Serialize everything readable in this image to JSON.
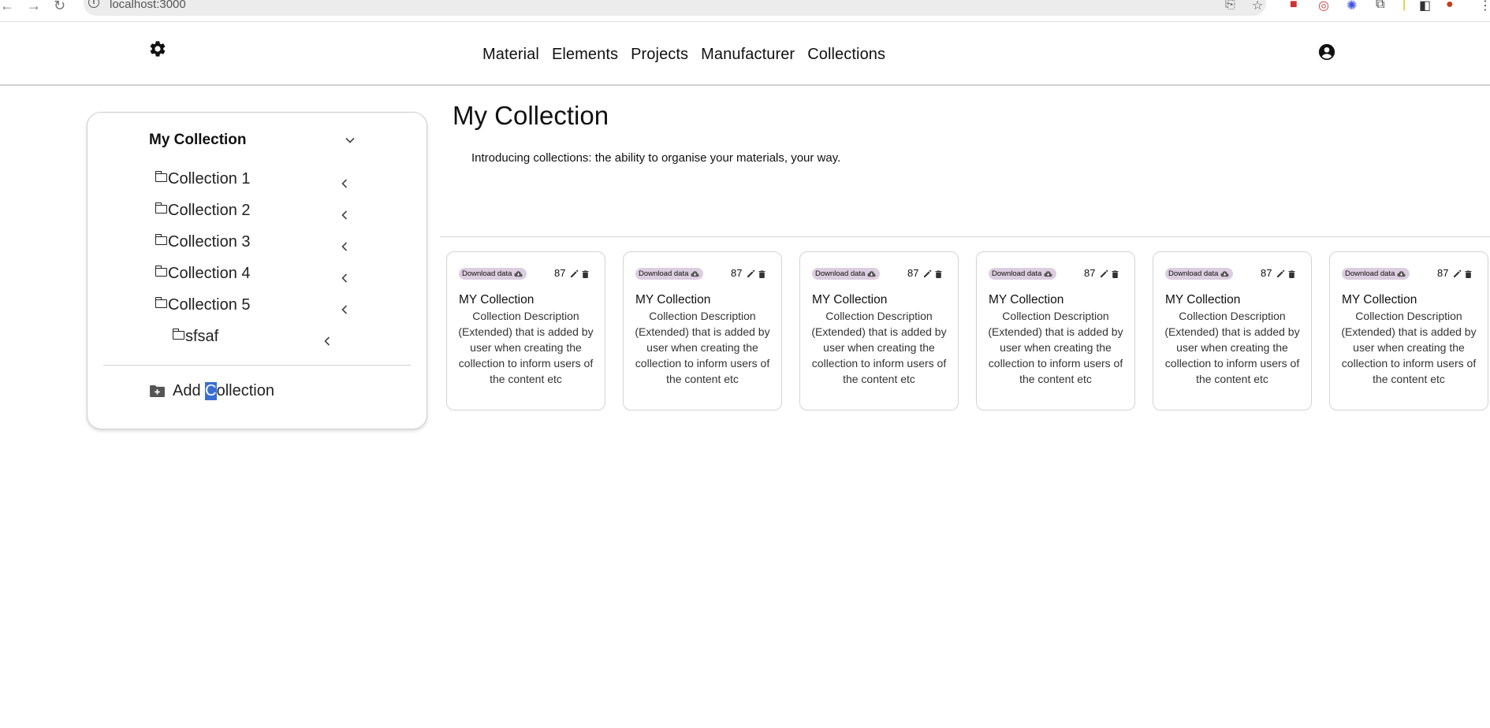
{
  "browser": {
    "url": "localhost:3000"
  },
  "header": {
    "nav": [
      "Material",
      "Elements",
      "Projects",
      "Manufacturer",
      "Collections"
    ]
  },
  "sidebar": {
    "title": "My Collection",
    "items": [
      {
        "label": "Collection 1"
      },
      {
        "label": "Collection 2"
      },
      {
        "label": "Collection 3"
      },
      {
        "label": "Collection 4"
      },
      {
        "label": "Collection 5"
      },
      {
        "label": "sfsaf"
      }
    ],
    "add_label_pre": "Add ",
    "add_label_sel": "C",
    "add_label_post": "ollection"
  },
  "main": {
    "title": "My Collection",
    "intro": "Introducing collections: the ability to organise your materials, your way."
  },
  "cards": [
    {
      "chip": "Download data",
      "count": "87",
      "title": "MY Collection",
      "description": "Collection Description (Extended) that is added by user when creating the collection to inform users of the content etc"
    },
    {
      "chip": "Download data",
      "count": "87",
      "title": "MY Collection",
      "description": "Collection Description (Extended) that is added by user when creating the collection to inform users of the content etc"
    },
    {
      "chip": "Download data",
      "count": "87",
      "title": "MY Collection",
      "description": "Collection Description (Extended) that is added by user when creating the collection to inform users of the content etc"
    },
    {
      "chip": "Download data",
      "count": "87",
      "title": "MY Collection",
      "description": "Collection Description (Extended) that is added by user when creating the collection to inform users of the content etc"
    },
    {
      "chip": "Download data",
      "count": "87",
      "title": "MY Collection",
      "description": "Collection Description (Extended) that is added by user when creating the collection to inform users of the content etc"
    },
    {
      "chip": "Download data",
      "count": "87",
      "title": "MY Collection",
      "description": "Collection Description (Extended) that is added by user when creating the collection to inform users of the content etc"
    }
  ],
  "colors": {
    "chip_bg": "#dccde0",
    "selection": "#3a6fd1"
  }
}
